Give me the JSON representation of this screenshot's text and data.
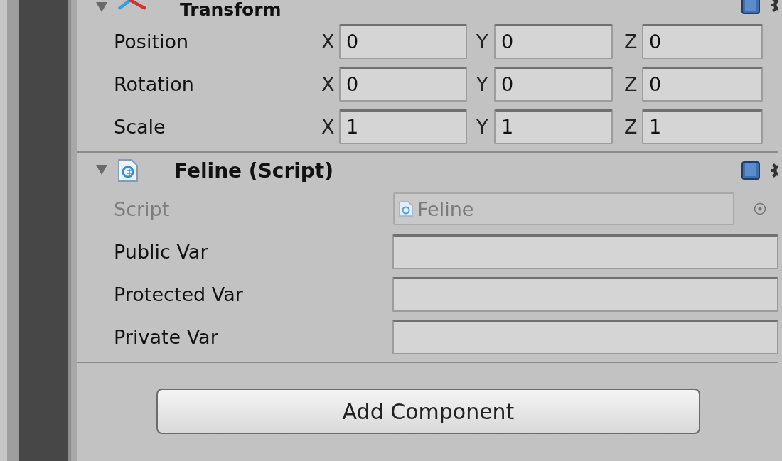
{
  "transform": {
    "title": "Transform",
    "expanded": true,
    "rows": [
      {
        "label": "Position",
        "fields": [
          {
            "axis": "X",
            "value": "0"
          },
          {
            "axis": "Y",
            "value": "0"
          },
          {
            "axis": "Z",
            "value": "0"
          }
        ]
      },
      {
        "label": "Rotation",
        "fields": [
          {
            "axis": "X",
            "value": "0"
          },
          {
            "axis": "Y",
            "value": "0"
          },
          {
            "axis": "Z",
            "value": "0"
          }
        ]
      },
      {
        "label": "Scale",
        "fields": [
          {
            "axis": "X",
            "value": "1"
          },
          {
            "axis": "Y",
            "value": "1"
          },
          {
            "axis": "Z",
            "value": "1"
          }
        ]
      }
    ]
  },
  "script_component": {
    "title": "Feline (Script)",
    "expanded": true,
    "properties": [
      {
        "label": "Script",
        "kind": "object",
        "value": "Feline",
        "disabled": true
      },
      {
        "label": "Public Var",
        "kind": "text",
        "disabled": false
      },
      {
        "label": "Protected Var",
        "kind": "text",
        "disabled": false
      },
      {
        "label": "Private Var",
        "kind": "text",
        "disabled": false
      }
    ]
  },
  "add_component_button": {
    "label": "Add Component"
  }
}
